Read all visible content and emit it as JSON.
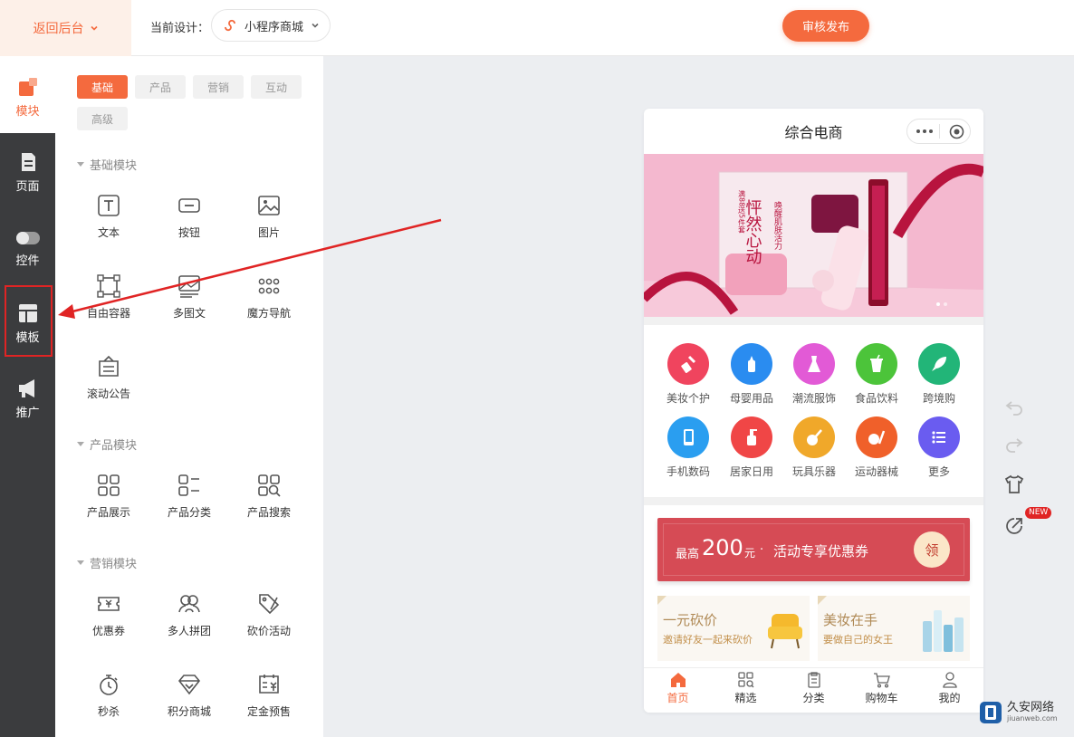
{
  "topbar": {
    "back_label": "返回后台",
    "design_label": "当前设计：",
    "design_value": "小程序商城",
    "publish_label": "审核发布"
  },
  "rail": {
    "items": [
      {
        "label": "模块",
        "icon": "blocks-icon"
      },
      {
        "label": "页面",
        "icon": "page-icon"
      },
      {
        "label": "控件",
        "icon": "toggle-icon"
      },
      {
        "label": "模板",
        "icon": "template-icon"
      },
      {
        "label": "推广",
        "icon": "megaphone-icon"
      }
    ]
  },
  "panel": {
    "tabs": [
      "基础",
      "产品",
      "营销",
      "互动",
      "高级"
    ],
    "sections": [
      {
        "title": "基础模块",
        "modules": [
          {
            "label": "文本",
            "icon": "text-icon"
          },
          {
            "label": "按钮",
            "icon": "button-icon"
          },
          {
            "label": "图片",
            "icon": "image-icon"
          },
          {
            "label": "自由容器",
            "icon": "container-icon"
          },
          {
            "label": "多图文",
            "icon": "multi-image-icon"
          },
          {
            "label": "魔方导航",
            "icon": "grid-nav-icon"
          },
          {
            "label": "滚动公告",
            "icon": "notice-icon"
          }
        ]
      },
      {
        "title": "产品模块",
        "modules": [
          {
            "label": "产品展示",
            "icon": "product-grid-icon"
          },
          {
            "label": "产品分类",
            "icon": "category-list-icon"
          },
          {
            "label": "产品搜索",
            "icon": "product-search-icon"
          }
        ]
      },
      {
        "title": "营销模块",
        "modules": [
          {
            "label": "优惠券",
            "icon": "coupon-icon"
          },
          {
            "label": "多人拼团",
            "icon": "group-buy-icon"
          },
          {
            "label": "砍价活动",
            "icon": "bargain-icon"
          },
          {
            "label": "秒杀",
            "icon": "stopwatch-icon"
          },
          {
            "label": "积分商城",
            "icon": "diamond-icon"
          },
          {
            "label": "定金预售",
            "icon": "presale-icon"
          }
        ]
      }
    ]
  },
  "phone": {
    "title": "综合电商",
    "banner": {
      "text_main": "怦然心动",
      "text_side": "唤醒肌肤活力",
      "tag": "满88送5件套"
    },
    "categories": [
      {
        "label": "美妆个护",
        "color": "#f0445e"
      },
      {
        "label": "母婴用品",
        "color": "#2a8cf0"
      },
      {
        "label": "潮流服饰",
        "color": "#e25ad6"
      },
      {
        "label": "食品饮料",
        "color": "#4cc43a"
      },
      {
        "label": "跨境购",
        "color": "#22b578"
      },
      {
        "label": "手机数码",
        "color": "#2a9ef0"
      },
      {
        "label": "居家日用",
        "color": "#f04646"
      },
      {
        "label": "玩具乐器",
        "color": "#f0a82a"
      },
      {
        "label": "运动器械",
        "color": "#f0602a"
      },
      {
        "label": "更多",
        "color": "#6a5cf0"
      }
    ],
    "coupon": {
      "prefix": "最高",
      "amount": "200",
      "unit": "元",
      "dot": "·",
      "text": "活动专享优惠券",
      "button": "领"
    },
    "promos": [
      {
        "title": "一元砍价",
        "subtitle": "邀请好友一起来砍价"
      },
      {
        "title": "美妆在手",
        "subtitle": "要做自己的女王"
      }
    ],
    "tabbar": [
      "首页",
      "精选",
      "分类",
      "购物车",
      "我的"
    ]
  },
  "tools": {
    "new_badge": "NEW"
  },
  "watermark": {
    "name": "久安网络",
    "url": "jiuanweb.com"
  }
}
